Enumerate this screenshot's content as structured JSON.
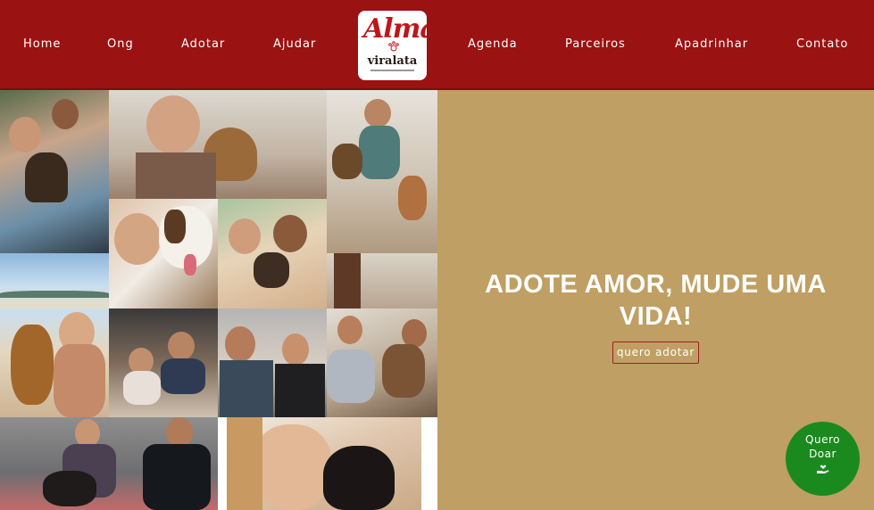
{
  "nav": {
    "home": "Home",
    "ong": "Ong",
    "adotar": "Adotar",
    "ajudar": "Ajudar",
    "agenda": "Agenda",
    "parceiros": "Parceiros",
    "apadrinhar": "Apadrinhar",
    "contato": "Contato"
  },
  "logo": {
    "alma": "Alma",
    "viralata": "viralata"
  },
  "hero": {
    "title": "ADOTE AMOR, MUDE UMA VIDA!",
    "button": "quero adotar"
  },
  "donate": {
    "label": "Quero\nDoar",
    "icon": "hand-heart-icon"
  },
  "colors": {
    "header": "#9b1212",
    "hero_bg": "#bf9f63",
    "donate_bg": "#1a8a1f",
    "logo_red": "#c0151b"
  }
}
